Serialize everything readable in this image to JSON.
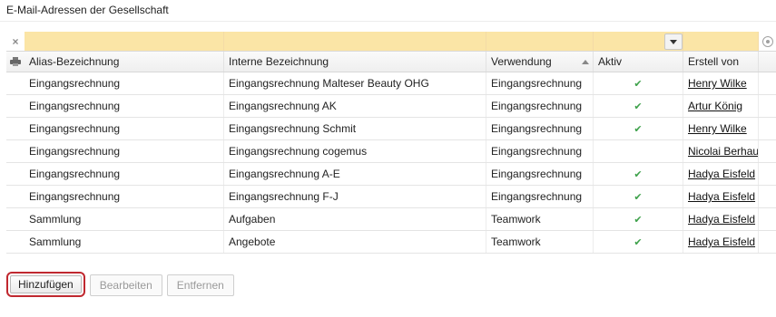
{
  "title": "E-Mail-Adressen der Gesellschaft",
  "colors": {
    "filter_bg": "#fbe5a6",
    "check": "#3da14a",
    "highlight": "#c0282f"
  },
  "icons": {
    "clear": "close-icon",
    "print": "printer-icon",
    "settings": "settings-circle-icon",
    "dropdown": "chevron-down-icon"
  },
  "filter_row": {
    "clear_glyph": "×"
  },
  "columns": [
    "Alias-Bezeichnung",
    "Interne Bezeichnung",
    "Verwendung",
    "Aktiv",
    "Erstell von"
  ],
  "rows": [
    {
      "alias": "Eingangsrechnung",
      "intern": "Eingangsrechnung Malteser Beauty OHG",
      "verwendung": "Eingangsrechnung",
      "aktiv": "✔",
      "erstellt": "Henry Wilke"
    },
    {
      "alias": "Eingangsrechnung",
      "intern": "Eingangsrechnung AK",
      "verwendung": "Eingangsrechnung",
      "aktiv": "✔",
      "erstellt": "Artur König"
    },
    {
      "alias": "Eingangsrechnung",
      "intern": "Eingangsrechnung Schmit",
      "verwendung": "Eingangsrechnung",
      "aktiv": "✔",
      "erstellt": "Henry Wilke"
    },
    {
      "alias": "Eingangsrechnung",
      "intern": "Eingangsrechnung cogemus",
      "verwendung": "Eingangsrechnung",
      "aktiv": "",
      "erstellt": "Nicolai Berhaus..."
    },
    {
      "alias": "Eingangsrechnung",
      "intern": "Eingangsrechnung A-E",
      "verwendung": "Eingangsrechnung",
      "aktiv": "✔",
      "erstellt": "Hadya Eisfeld"
    },
    {
      "alias": "Eingangsrechnung",
      "intern": "Eingangsrechnung F-J",
      "verwendung": "Eingangsrechnung",
      "aktiv": "✔",
      "erstellt": "Hadya Eisfeld"
    },
    {
      "alias": "Sammlung",
      "intern": "Aufgaben",
      "verwendung": "Teamwork",
      "aktiv": "✔",
      "erstellt": "Hadya Eisfeld"
    },
    {
      "alias": "Sammlung",
      "intern": "Angebote",
      "verwendung": "Teamwork",
      "aktiv": "✔",
      "erstellt": "Hadya Eisfeld"
    }
  ],
  "buttons": {
    "add": "Hinzufügen",
    "edit": "Bearbeiten",
    "remove": "Entfernen"
  }
}
